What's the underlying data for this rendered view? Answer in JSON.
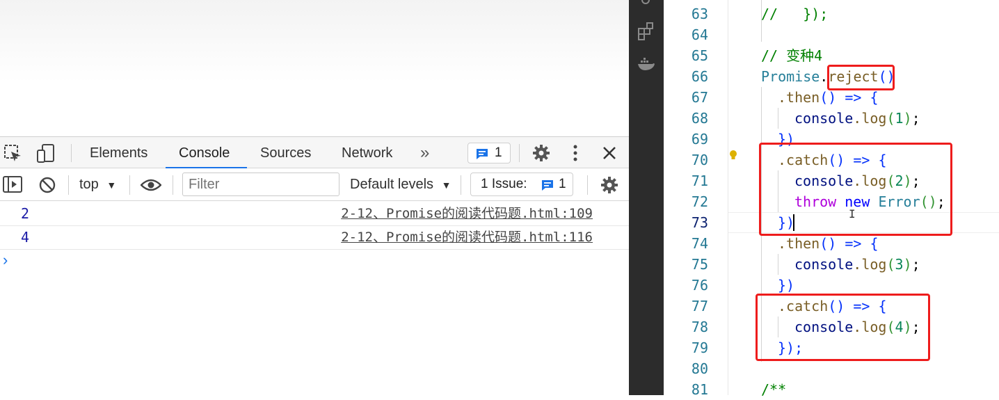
{
  "devtools": {
    "tabs": [
      "Elements",
      "Console",
      "Sources",
      "Network"
    ],
    "active_tab": "Console",
    "overflow": "»",
    "messages_badge": "1",
    "toolbar": {
      "context": "top",
      "filter_placeholder": "Filter",
      "levels": "Default levels",
      "issues_label": "1 Issue:",
      "issues_count": "1"
    },
    "console_logs": [
      {
        "value": "2",
        "source": "2-12、Promise的阅读代码题.html:109"
      },
      {
        "value": "4",
        "source": "2-12、Promise的阅读代码题.html:116"
      }
    ],
    "prompt": "›"
  },
  "editor": {
    "line_numbers": [
      "63",
      "64",
      "65",
      "66",
      "67",
      "68",
      "69",
      "70",
      "71",
      "72",
      "73",
      "74",
      "75",
      "76",
      "77",
      "78",
      "79",
      "80",
      "81"
    ],
    "current_line": "73",
    "lines": {
      "l63": "//   });",
      "l65": "// 变种4",
      "l66": {
        "obj": "Promise",
        "dot": ".",
        "method": "reject",
        "open": "(",
        "close": ")"
      },
      "then": ".then",
      "catch": ".catch",
      "arrow": "() => {",
      "console": "console",
      "log": ".log",
      "args": [
        "1",
        "2",
        "3",
        "4"
      ],
      "throw": "throw",
      "new": "new",
      "error": "Error",
      "close_brace": "})",
      "close_final": "});",
      "l81": "/**"
    }
  }
}
